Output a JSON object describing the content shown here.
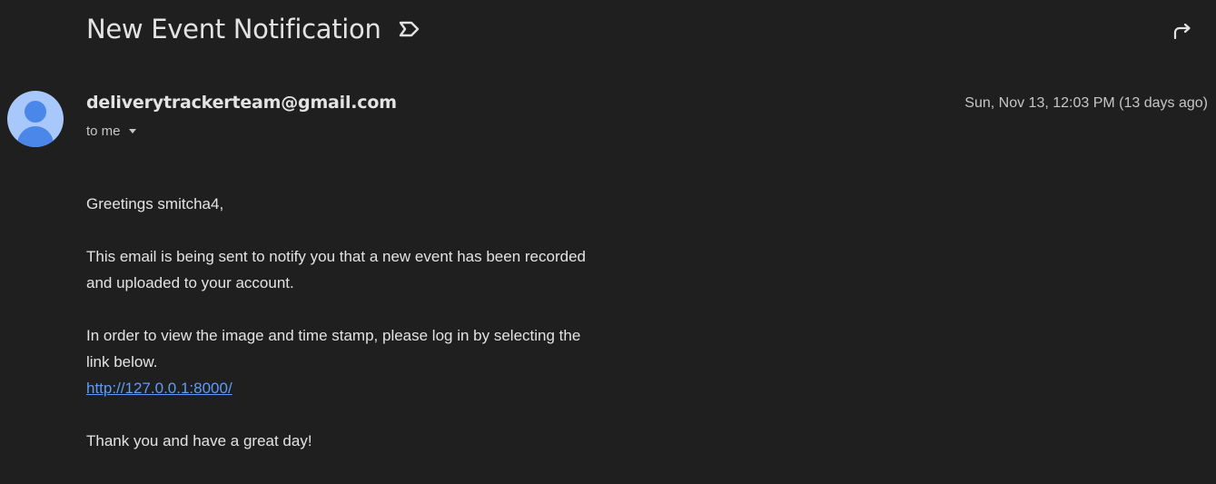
{
  "email": {
    "subject": "New Event Notification",
    "sender": "deliverytrackerteam@gmail.com",
    "recipient_label": "to me",
    "date": "Sun, Nov 13, 12:03 PM (13 days ago)",
    "body": {
      "greeting": "Greetings smitcha4,",
      "para1_line1": "This email is being sent to notify you that a new event has been recorded",
      "para1_line2": "and uploaded to your account.",
      "para2_line1": "In order to view the image and time stamp, please log in by selecting the",
      "para2_line2": "link below.",
      "link": "http://127.0.0.1:8000/",
      "closing": "Thank you and have a great day!"
    }
  },
  "icons": {
    "label": "label-icon",
    "forward": "forward-icon",
    "avatar": "avatar-person-icon",
    "caret": "caret-down-icon"
  },
  "colors": {
    "background": "#1f1f1f",
    "text": "#e3e3e3",
    "secondary_text": "#c4c7c5",
    "link": "#8ab4f8",
    "avatar_bg": "#a8c7fa",
    "avatar_fg": "#4a87e8"
  }
}
